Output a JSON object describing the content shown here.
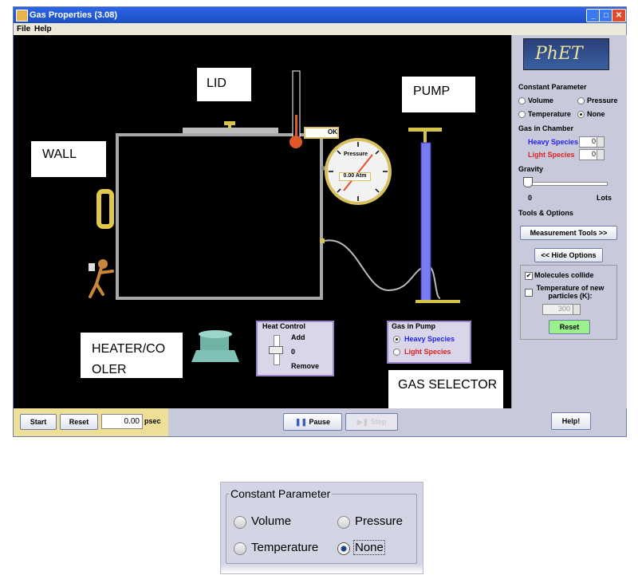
{
  "window": {
    "title": "Gas Properties (3.08)"
  },
  "menu": [
    "File",
    "Help"
  ],
  "annotations": {
    "lid": "LID",
    "wall": "WALL",
    "pump": "PUMP",
    "heater": "HEATER/CO OLER",
    "gas_selector": "GAS SELECTOR"
  },
  "gauge": {
    "title": "Pressure",
    "value": "0.00 Atm"
  },
  "thermometer": {
    "value": "OK"
  },
  "heat_control": {
    "title": "Heat Control",
    "add": "Add",
    "zero": "0",
    "remove": "Remove"
  },
  "gas_in_pump": {
    "title": "Gas in Pump",
    "heavy": "Heavy Species",
    "light": "Light Species",
    "selected": "Heavy Species"
  },
  "panel": {
    "logo": "PhET",
    "constant_parameter": "Constant Parameter",
    "volume": "Volume",
    "pressure": "Pressure",
    "temperature": "Temperature",
    "none": "None",
    "gas_in_chamber": "Gas in Chamber",
    "heavy_species": "Heavy Species",
    "heavy_count": "0",
    "light_species": "Light Species",
    "light_count": "0",
    "gravity": "Gravity",
    "gravity_min": "0",
    "gravity_max": "Lots",
    "tools_options": "Tools & Options",
    "measurement_tools": "Measurement Tools >>",
    "hide_options": "<< Hide Options",
    "molecules_collide": "Molecules collide",
    "temp_new_particles": "Temperature of new particles (K):",
    "temp_value": "300",
    "reset": "Reset"
  },
  "bottom": {
    "start": "Start",
    "reset": "Reset",
    "time_value": "0.00",
    "time_unit": "psec",
    "pause": "Pause",
    "step": "Step",
    "help": "Help!"
  },
  "zoom": {
    "title": "Constant Parameter",
    "volume": "Volume",
    "pressure": "Pressure",
    "temperature": "Temperature",
    "none": "None"
  },
  "colors": {
    "heavy": "#2222ee",
    "light": "#dd2222",
    "pump": "#7a7af0"
  }
}
